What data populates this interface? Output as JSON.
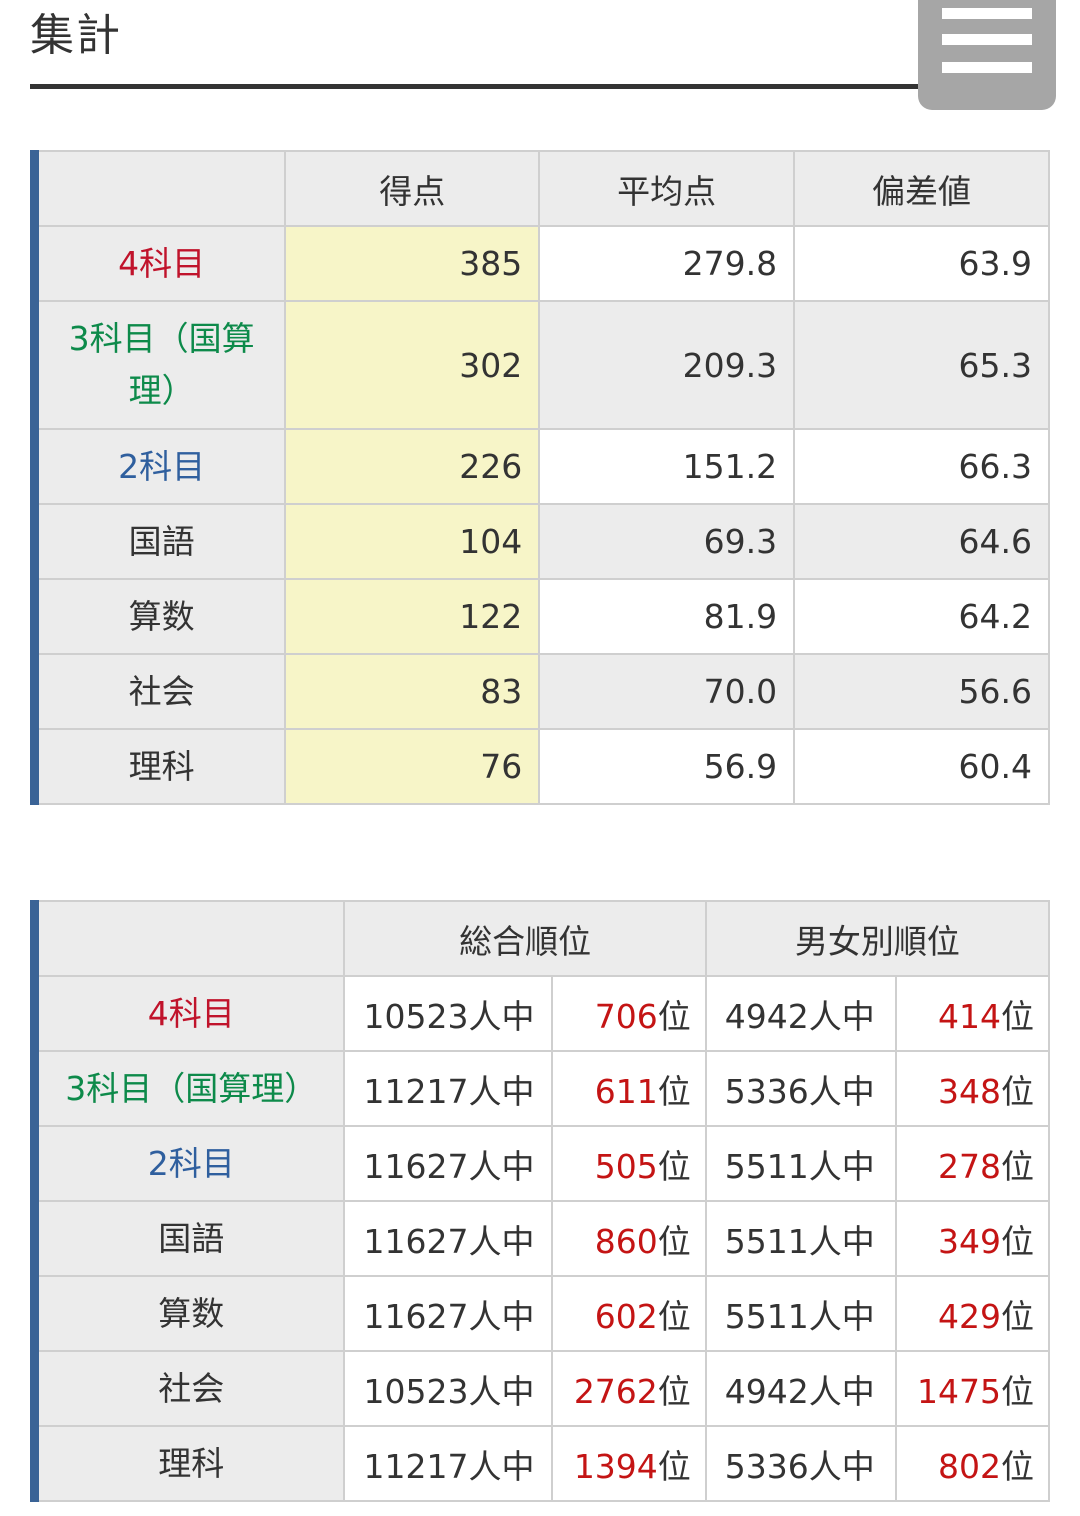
{
  "header": {
    "title": "集計"
  },
  "colors": {
    "accent_border": "#3a6396",
    "score_highlight": "#f7f5c8",
    "rank_red": "#c41414"
  },
  "score_table": {
    "columns": [
      "",
      "得点",
      "平均点",
      "偏差値"
    ],
    "rows": [
      {
        "label": "4科目",
        "score": "385",
        "average": "279.8",
        "deviation": "63.9"
      },
      {
        "label": "3科目（国算理）",
        "score": "302",
        "average": "209.3",
        "deviation": "65.3"
      },
      {
        "label": "2科目",
        "score": "226",
        "average": "151.2",
        "deviation": "66.3"
      },
      {
        "label": "国語",
        "score": "104",
        "average": "69.3",
        "deviation": "64.6"
      },
      {
        "label": "算数",
        "score": "122",
        "average": "81.9",
        "deviation": "64.2"
      },
      {
        "label": "社会",
        "score": "83",
        "average": "70.0",
        "deviation": "56.6"
      },
      {
        "label": "理科",
        "score": "76",
        "average": "56.9",
        "deviation": "60.4"
      }
    ]
  },
  "rank_table": {
    "columns": [
      "",
      "総合順位",
      "男女別順位"
    ],
    "unit_of": "人中",
    "unit_rank": "位",
    "rows": [
      {
        "label": "4科目",
        "total_of": "10523",
        "total_rank": "706",
        "gender_of": "4942",
        "gender_rank": "414"
      },
      {
        "label": "3科目（国算理）",
        "total_of": "11217",
        "total_rank": "611",
        "gender_of": "5336",
        "gender_rank": "348"
      },
      {
        "label": "2科目",
        "total_of": "11627",
        "total_rank": "505",
        "gender_of": "5511",
        "gender_rank": "278"
      },
      {
        "label": "国語",
        "total_of": "11627",
        "total_rank": "860",
        "gender_of": "5511",
        "gender_rank": "349"
      },
      {
        "label": "算数",
        "total_of": "11627",
        "total_rank": "602",
        "gender_of": "5511",
        "gender_rank": "429"
      },
      {
        "label": "社会",
        "total_of": "10523",
        "total_rank": "2762",
        "gender_of": "4942",
        "gender_rank": "1475"
      },
      {
        "label": "理科",
        "total_of": "11217",
        "total_rank": "1394",
        "gender_of": "5336",
        "gender_rank": "802"
      }
    ]
  }
}
